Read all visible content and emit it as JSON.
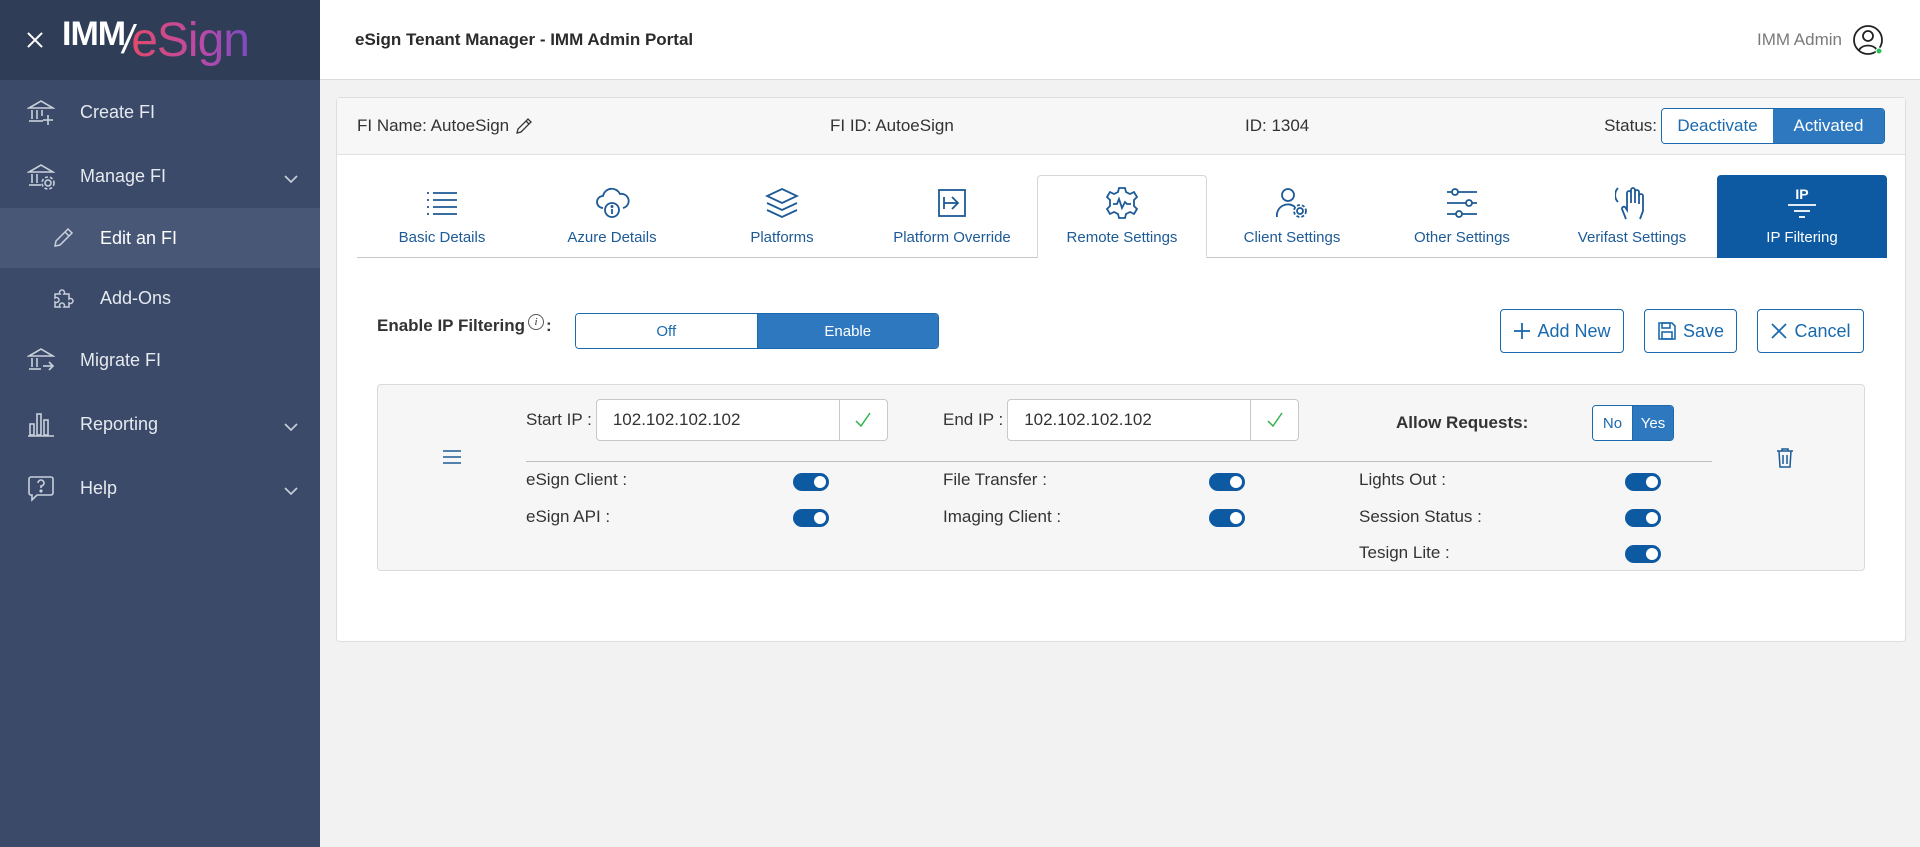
{
  "app": {
    "logo_imm": "IMM",
    "logo_esign": "eSign",
    "title": "eSign Tenant Manager - IMM Admin Portal",
    "user": "IMM Admin"
  },
  "sidebar": {
    "items": [
      {
        "label": "Create FI",
        "icon": "bank-add-icon"
      },
      {
        "label": "Manage FI",
        "icon": "bank-gear-icon"
      },
      {
        "label": "Edit an FI",
        "icon": "pencil-icon"
      },
      {
        "label": "Add-Ons",
        "icon": "puzzle-icon"
      },
      {
        "label": "Migrate FI",
        "icon": "bank-arrow-icon"
      },
      {
        "label": "Reporting",
        "icon": "bar-chart-icon"
      },
      {
        "label": "Help",
        "icon": "help-bubble-icon"
      }
    ]
  },
  "fi": {
    "name_label": "FI Name: AutoeSign",
    "id_label": "FI ID: AutoeSign",
    "num_id_label": "ID: 1304",
    "status_label": "Status:",
    "deactivate": "Deactivate",
    "activated": "Activated"
  },
  "tabs": [
    {
      "label": "Basic Details",
      "icon": "list-icon"
    },
    {
      "label": "Azure Details",
      "icon": "cloud-info-icon"
    },
    {
      "label": "Platforms",
      "icon": "layers-icon"
    },
    {
      "label": "Platform Override",
      "icon": "arrow-box-icon"
    },
    {
      "label": "Remote Settings",
      "icon": "gear-wave-icon"
    },
    {
      "label": "Client Settings",
      "icon": "user-gear-icon"
    },
    {
      "label": "Other Settings",
      "icon": "sliders-icon"
    },
    {
      "label": "Verifast Settings",
      "icon": "hand-touch-icon"
    },
    {
      "label": "IP Filtering",
      "icon": "ip-filter-icon",
      "icon_text": "IP"
    }
  ],
  "ip_filtering": {
    "enable_label": "Enable IP Filtering",
    "colon": ":",
    "info": "i",
    "off": "Off",
    "enable": "Enable",
    "add_new": "Add New",
    "save": "Save",
    "cancel": "Cancel"
  },
  "rule": {
    "start_label": "Start IP :",
    "start_value": "102.102.102.102",
    "end_label": "End IP :",
    "end_value": "102.102.102.102",
    "allow_label": "Allow Requests:",
    "no": "No",
    "yes": "Yes",
    "permissions": [
      "eSign Client :",
      "eSign API :",
      "File Transfer :",
      "Imaging Client :",
      "Lights Out :",
      "Session Status :",
      "Tesign Lite :"
    ]
  },
  "colors": {
    "sidebar": "#3a4a68",
    "primary": "#0d5aa2",
    "accent": "#2d78bf"
  }
}
